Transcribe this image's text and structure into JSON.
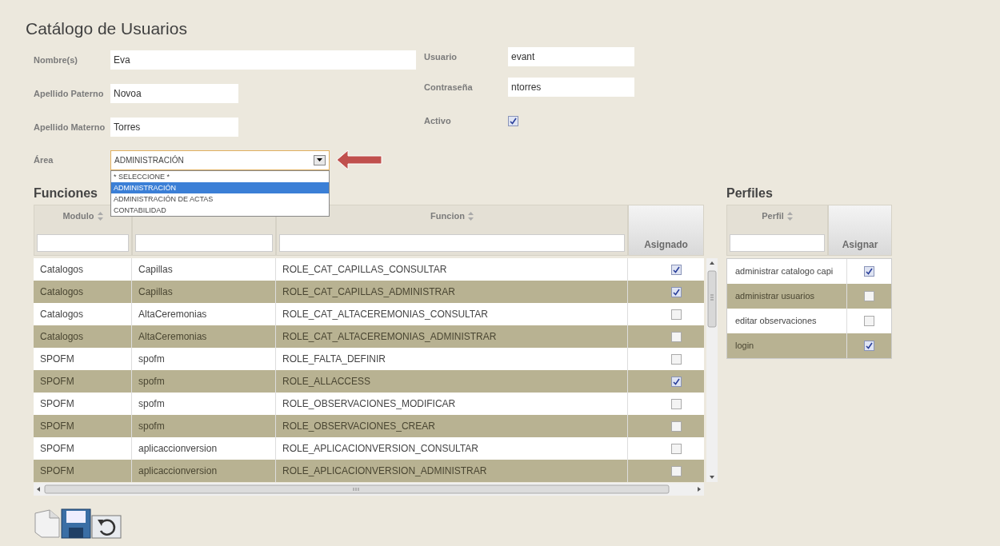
{
  "title": "Catálogo de Usuarios",
  "left_fields": [
    {
      "label": "Nombre(s)",
      "value": "Eva"
    },
    {
      "label": "Apellido Paterno",
      "value": "Novoa"
    },
    {
      "label": "Apellido Materno",
      "value": "Torres"
    }
  ],
  "right_fields": [
    {
      "kind": "text",
      "label": "Usuario",
      "value": "evant"
    },
    {
      "kind": "text",
      "label": "Contraseña",
      "value": "ntorres"
    },
    {
      "kind": "checkbox",
      "label": "Activo",
      "checked": true
    }
  ],
  "area": {
    "label": "Área",
    "value": "ADMINISTRACIÓN",
    "expanded": true,
    "options": [
      {
        "label": "* SELECCIONE *",
        "selected": false
      },
      {
        "label": "ADMINISTRACIÓN",
        "selected": true
      },
      {
        "label": "ADMINISTRACIÓN DE ACTAS",
        "selected": false
      },
      {
        "label": "CONTABILIDAD",
        "selected": false
      }
    ]
  },
  "funciones": {
    "title": "Funciones",
    "columns": [
      {
        "kind": "sortable",
        "label": "Modulo"
      },
      {
        "kind": "filter"
      },
      {
        "kind": "sortable",
        "label": "Funcion"
      },
      {
        "kind": "action",
        "label": "Asignado"
      }
    ],
    "rows": [
      {
        "cells": [
          "Catalogos",
          "Capillas",
          "ROLE_CAT_CAPILLAS_CONSULTAR"
        ],
        "checked": true
      },
      {
        "cells": [
          "Catalogos",
          "Capillas",
          "ROLE_CAT_CAPILLAS_ADMINISTRAR"
        ],
        "checked": true
      },
      {
        "cells": [
          "Catalogos",
          "AltaCeremonias",
          "ROLE_CAT_ALTACEREMONIAS_CONSULTAR"
        ],
        "checked": false
      },
      {
        "cells": [
          "Catalogos",
          "AltaCeremonias",
          "ROLE_CAT_ALTACEREMONIAS_ADMINISTRAR"
        ],
        "checked": false
      },
      {
        "cells": [
          "SPOFM",
          "spofm",
          "ROLE_FALTA_DEFINIR"
        ],
        "checked": false
      },
      {
        "cells": [
          "SPOFM",
          "spofm",
          "ROLE_ALLACCESS"
        ],
        "checked": true
      },
      {
        "cells": [
          "SPOFM",
          "spofm",
          "ROLE_OBSERVACIONES_MODIFICAR"
        ],
        "checked": false
      },
      {
        "cells": [
          "SPOFM",
          "spofm",
          "ROLE_OBSERVACIONES_CREAR"
        ],
        "checked": false
      },
      {
        "cells": [
          "SPOFM",
          "aplicaccionversion",
          "ROLE_APLICACIONVERSION_CONSULTAR"
        ],
        "checked": false
      },
      {
        "cells": [
          "SPOFM",
          "aplicaccionversion",
          "ROLE_APLICACIONVERSION_ADMINISTRAR"
        ],
        "checked": false
      }
    ]
  },
  "perfiles": {
    "title": "Perfiles",
    "columns": [
      {
        "kind": "sortable",
        "label": "Perfil"
      },
      {
        "kind": "action",
        "label": "Asignar"
      }
    ],
    "rows": [
      {
        "cells": [
          "administrar catalogo capi"
        ],
        "checked": true
      },
      {
        "cells": [
          "administrar usuarios"
        ],
        "checked": false
      },
      {
        "cells": [
          "editar observaciones"
        ],
        "checked": false
      },
      {
        "cells": [
          "login"
        ],
        "checked": true
      }
    ]
  }
}
